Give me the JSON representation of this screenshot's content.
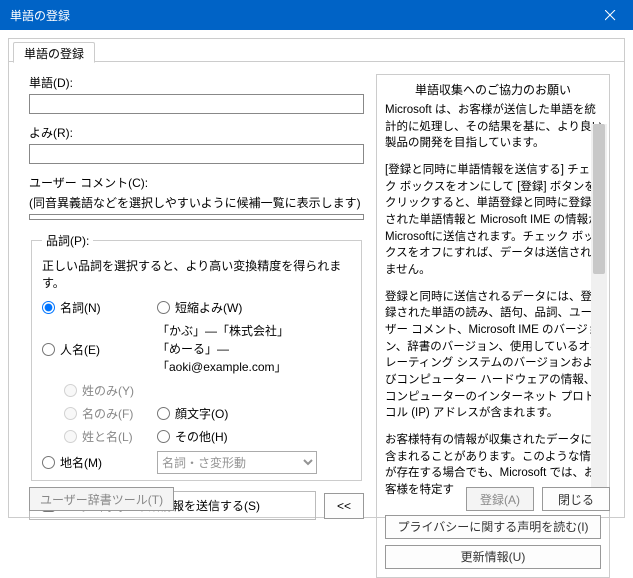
{
  "window": {
    "title": "単語の登録"
  },
  "tab": {
    "label": "単語の登録"
  },
  "fields": {
    "word_label": "単語(D):",
    "reading_label": "よみ(R):",
    "comment_label": "ユーザー コメント(C):",
    "comment_hint": "(同音異義語などを選択しやすいように候補一覧に表示します)"
  },
  "pos": {
    "legend": "品詞(P):",
    "desc": "正しい品詞を選択すると、より高い変換精度を得られます。",
    "noun": "名詞(N)",
    "person": "人名(E)",
    "surname_only": "姓のみ(Y)",
    "given_only": "名のみ(F)",
    "fullname": "姓と名(L)",
    "place": "地名(M)",
    "abbrev": "短縮よみ(W)",
    "ex1": "「かぶ」―「株式会社」",
    "ex2": "「めーる」―「aoki@example.com」",
    "face": "顔文字(O)",
    "other": "その他(H)",
    "yougen_placeholder": "名詞・さ変形動"
  },
  "send": {
    "checkbox": "登録と同時に単語情報を送信する(S)",
    "back": "<<"
  },
  "footer": {
    "dict_tool": "ユーザー辞書ツール(T)",
    "register": "登録(A)",
    "close": "閉じる"
  },
  "right": {
    "title": "単語収集へのご協力のお願い",
    "p1": "Microsoft は、お客様が送信した単語を統計的に処理し、その結果を基に、より良い製品の開発を目指しています。",
    "p2": "[登録と同時に単語情報を送信する] チェック ボックスをオンにして [登録] ボタンをクリックすると、単語登録と同時に登録された単語情報と Microsoft IME の情報が Microsoftに送信されます。チェック ボックスをオフにすれば、データは送信されません。",
    "p3": "登録と同時に送信されるデータには、登録された単語の読み、語句、品詞、ユーザー コメント、Microsoft IME のバージョン、辞書のバージョン、使用しているオペレーティング システムのバージョンおよびコンピューター ハードウェアの情報、コンピューターのインターネット プロトコル (IP) アドレスが含まれます。",
    "p4": "お客様特有の情報が収集されたデータに含まれることがあります。このような情報が存在する場合でも、Microsoft では、お客様を特定す",
    "privacy_btn": "プライバシーに関する声明を読む(I)",
    "update_btn": "更新情報(U)"
  }
}
